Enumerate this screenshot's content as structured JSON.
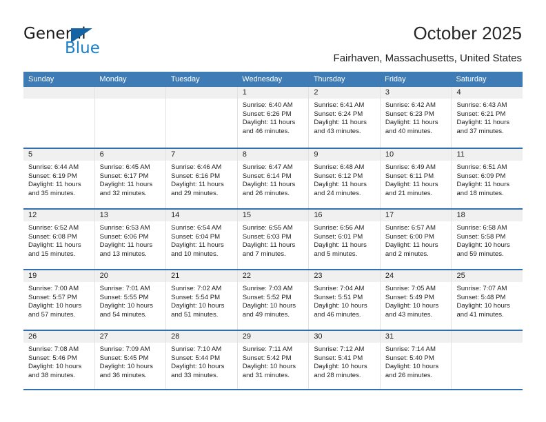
{
  "brand": {
    "name_top": "General",
    "name_bottom": "Blue",
    "accent_color": "#1a7ec8",
    "triangle_color": "#1464a5"
  },
  "header": {
    "title": "October 2025",
    "location": "Fairhaven, Massachusetts, United States"
  },
  "theme": {
    "header_bg": "#3f7cb5",
    "week_divider": "#2f6fae",
    "daynum_band_bg": "#f0f0f0",
    "cell_bg": "#ffffff"
  },
  "weekday_headers": [
    "Sunday",
    "Monday",
    "Tuesday",
    "Wednesday",
    "Thursday",
    "Friday",
    "Saturday"
  ],
  "weeks": [
    [
      {
        "day": "",
        "sunrise": "",
        "sunset": "",
        "daylight": "",
        "empty": true
      },
      {
        "day": "",
        "sunrise": "",
        "sunset": "",
        "daylight": "",
        "empty": true
      },
      {
        "day": "",
        "sunrise": "",
        "sunset": "",
        "daylight": "",
        "empty": true
      },
      {
        "day": "1",
        "sunrise": "Sunrise: 6:40 AM",
        "sunset": "Sunset: 6:26 PM",
        "daylight": "Daylight: 11 hours and 46 minutes."
      },
      {
        "day": "2",
        "sunrise": "Sunrise: 6:41 AM",
        "sunset": "Sunset: 6:24 PM",
        "daylight": "Daylight: 11 hours and 43 minutes."
      },
      {
        "day": "3",
        "sunrise": "Sunrise: 6:42 AM",
        "sunset": "Sunset: 6:23 PM",
        "daylight": "Daylight: 11 hours and 40 minutes."
      },
      {
        "day": "4",
        "sunrise": "Sunrise: 6:43 AM",
        "sunset": "Sunset: 6:21 PM",
        "daylight": "Daylight: 11 hours and 37 minutes."
      }
    ],
    [
      {
        "day": "5",
        "sunrise": "Sunrise: 6:44 AM",
        "sunset": "Sunset: 6:19 PM",
        "daylight": "Daylight: 11 hours and 35 minutes."
      },
      {
        "day": "6",
        "sunrise": "Sunrise: 6:45 AM",
        "sunset": "Sunset: 6:17 PM",
        "daylight": "Daylight: 11 hours and 32 minutes."
      },
      {
        "day": "7",
        "sunrise": "Sunrise: 6:46 AM",
        "sunset": "Sunset: 6:16 PM",
        "daylight": "Daylight: 11 hours and 29 minutes."
      },
      {
        "day": "8",
        "sunrise": "Sunrise: 6:47 AM",
        "sunset": "Sunset: 6:14 PM",
        "daylight": "Daylight: 11 hours and 26 minutes."
      },
      {
        "day": "9",
        "sunrise": "Sunrise: 6:48 AM",
        "sunset": "Sunset: 6:12 PM",
        "daylight": "Daylight: 11 hours and 24 minutes."
      },
      {
        "day": "10",
        "sunrise": "Sunrise: 6:49 AM",
        "sunset": "Sunset: 6:11 PM",
        "daylight": "Daylight: 11 hours and 21 minutes."
      },
      {
        "day": "11",
        "sunrise": "Sunrise: 6:51 AM",
        "sunset": "Sunset: 6:09 PM",
        "daylight": "Daylight: 11 hours and 18 minutes."
      }
    ],
    [
      {
        "day": "12",
        "sunrise": "Sunrise: 6:52 AM",
        "sunset": "Sunset: 6:08 PM",
        "daylight": "Daylight: 11 hours and 15 minutes."
      },
      {
        "day": "13",
        "sunrise": "Sunrise: 6:53 AM",
        "sunset": "Sunset: 6:06 PM",
        "daylight": "Daylight: 11 hours and 13 minutes."
      },
      {
        "day": "14",
        "sunrise": "Sunrise: 6:54 AM",
        "sunset": "Sunset: 6:04 PM",
        "daylight": "Daylight: 11 hours and 10 minutes."
      },
      {
        "day": "15",
        "sunrise": "Sunrise: 6:55 AM",
        "sunset": "Sunset: 6:03 PM",
        "daylight": "Daylight: 11 hours and 7 minutes."
      },
      {
        "day": "16",
        "sunrise": "Sunrise: 6:56 AM",
        "sunset": "Sunset: 6:01 PM",
        "daylight": "Daylight: 11 hours and 5 minutes."
      },
      {
        "day": "17",
        "sunrise": "Sunrise: 6:57 AM",
        "sunset": "Sunset: 6:00 PM",
        "daylight": "Daylight: 11 hours and 2 minutes."
      },
      {
        "day": "18",
        "sunrise": "Sunrise: 6:58 AM",
        "sunset": "Sunset: 5:58 PM",
        "daylight": "Daylight: 10 hours and 59 minutes."
      }
    ],
    [
      {
        "day": "19",
        "sunrise": "Sunrise: 7:00 AM",
        "sunset": "Sunset: 5:57 PM",
        "daylight": "Daylight: 10 hours and 57 minutes."
      },
      {
        "day": "20",
        "sunrise": "Sunrise: 7:01 AM",
        "sunset": "Sunset: 5:55 PM",
        "daylight": "Daylight: 10 hours and 54 minutes."
      },
      {
        "day": "21",
        "sunrise": "Sunrise: 7:02 AM",
        "sunset": "Sunset: 5:54 PM",
        "daylight": "Daylight: 10 hours and 51 minutes."
      },
      {
        "day": "22",
        "sunrise": "Sunrise: 7:03 AM",
        "sunset": "Sunset: 5:52 PM",
        "daylight": "Daylight: 10 hours and 49 minutes."
      },
      {
        "day": "23",
        "sunrise": "Sunrise: 7:04 AM",
        "sunset": "Sunset: 5:51 PM",
        "daylight": "Daylight: 10 hours and 46 minutes."
      },
      {
        "day": "24",
        "sunrise": "Sunrise: 7:05 AM",
        "sunset": "Sunset: 5:49 PM",
        "daylight": "Daylight: 10 hours and 43 minutes."
      },
      {
        "day": "25",
        "sunrise": "Sunrise: 7:07 AM",
        "sunset": "Sunset: 5:48 PM",
        "daylight": "Daylight: 10 hours and 41 minutes."
      }
    ],
    [
      {
        "day": "26",
        "sunrise": "Sunrise: 7:08 AM",
        "sunset": "Sunset: 5:46 PM",
        "daylight": "Daylight: 10 hours and 38 minutes."
      },
      {
        "day": "27",
        "sunrise": "Sunrise: 7:09 AM",
        "sunset": "Sunset: 5:45 PM",
        "daylight": "Daylight: 10 hours and 36 minutes."
      },
      {
        "day": "28",
        "sunrise": "Sunrise: 7:10 AM",
        "sunset": "Sunset: 5:44 PM",
        "daylight": "Daylight: 10 hours and 33 minutes."
      },
      {
        "day": "29",
        "sunrise": "Sunrise: 7:11 AM",
        "sunset": "Sunset: 5:42 PM",
        "daylight": "Daylight: 10 hours and 31 minutes."
      },
      {
        "day": "30",
        "sunrise": "Sunrise: 7:12 AM",
        "sunset": "Sunset: 5:41 PM",
        "daylight": "Daylight: 10 hours and 28 minutes."
      },
      {
        "day": "31",
        "sunrise": "Sunrise: 7:14 AM",
        "sunset": "Sunset: 5:40 PM",
        "daylight": "Daylight: 10 hours and 26 minutes."
      },
      {
        "day": "",
        "sunrise": "",
        "sunset": "",
        "daylight": "",
        "empty": true
      }
    ]
  ]
}
